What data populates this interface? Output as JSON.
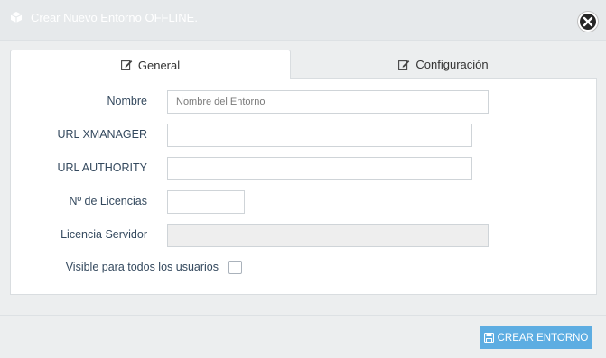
{
  "dialog": {
    "title": "Crear Nuevo Entorno OFFLINE.",
    "icon": "cube-icon",
    "close_icon": "close-icon"
  },
  "tabs": [
    {
      "label": "General",
      "icon": "edit-icon",
      "active": true
    },
    {
      "label": "Configuración",
      "icon": "edit-icon",
      "active": false
    }
  ],
  "form": {
    "nombre": {
      "label": "Nombre",
      "value": "",
      "placeholder": "Nombre del Entorno"
    },
    "url_xmanager": {
      "label": "URL XMANAGER",
      "value": ""
    },
    "url_authority": {
      "label": "URL AUTHORITY",
      "value": ""
    },
    "licencias": {
      "label": "Nº de Licencias",
      "value": ""
    },
    "licencia_servidor": {
      "label": "Licencia Servidor",
      "value": "",
      "disabled": true
    },
    "visible": {
      "label": "Visible para todos los usuarios",
      "checked": false
    }
  },
  "footer": {
    "create_label": "CREAR ENTORNO",
    "create_icon": "save-icon",
    "button_color": "#5dade2"
  },
  "colors": {
    "label_text": "#34495e",
    "header_bg": "#e6e9eb"
  }
}
